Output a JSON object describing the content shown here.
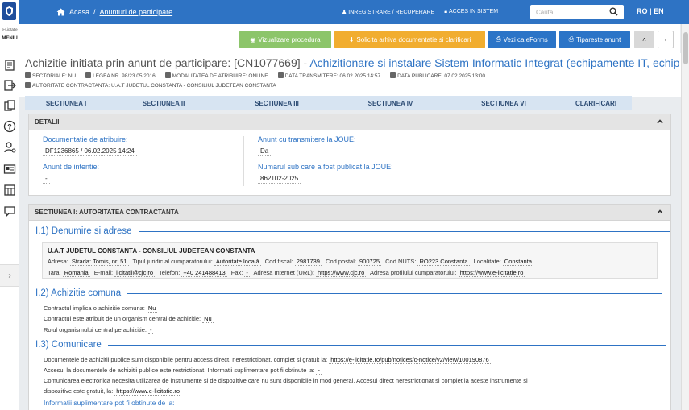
{
  "sidebar": {
    "brand_small": "e-Licitatie",
    "menu_label": "MENIU",
    "icons": [
      "list-icon",
      "export-icon",
      "documents-icon",
      "help-icon",
      "user-settings-icon",
      "id-card-icon",
      "register-icon",
      "chat-icon"
    ],
    "expand_glyph": "›"
  },
  "topbar": {
    "home_label": "Acasa",
    "separator": "/",
    "breadcrumb_link": "Anunturi de participare",
    "register_label": "INREGISTRARE / RECUPERARE",
    "access_label": "ACCES IN SISTEM",
    "search_placeholder": "Cauta...",
    "lang_ro": "RO",
    "lang_sep": "|",
    "lang_en": "EN"
  },
  "actions": {
    "view_label": "Vizualizare procedura",
    "archive_label": "Solicita arhiva documentatie si clarificari",
    "eforms_label": "Vezi ca eForms",
    "print_label": "Tipareste anunt",
    "up_glyph": "˄",
    "left_glyph": "‹"
  },
  "header": {
    "title_prefix": "Achizitie initiata prin anunt de participare: [CN1077669] - ",
    "title_link": "Achizitionare si instalare Sistem Informatic Integrat (echipamente IT, echipam...",
    "meta": [
      "SECTORIALE: NU",
      "LEGEA NR. 98/23.05.2016",
      "MODALITATEA DE ATRIBUIRE: ONLINE",
      "DATA TRANSMITERE: 06.02.2025 14:57",
      "DATA PUBLICARE: 07.02.2025 13:00"
    ],
    "authority": "AUTORITATE CONTRACTANTA: U.A.T JUDETUL CONSTANTA - CONSILIUL JUDETEAN CONSTANTA"
  },
  "tabs": [
    "SECTIUNEA I",
    "SECTIUNEA II",
    "SECTIUNEA III",
    "SECTIUNEA IV",
    "SECTIUNEA VI",
    "CLARIFICARI"
  ],
  "detalii": {
    "header": "DETALII",
    "doc_label": "Documentatie de atribuire:",
    "doc_value": "DF1236865 / 06.02.2025 14:24",
    "intent_label": "Anunt de intentie:",
    "intent_value": "-",
    "joue_label": "Anunt cu transmitere la JOUE:",
    "joue_value": "Da",
    "joue_num_label": "Numarul sub care a fost publicat la JOUE:",
    "joue_num_value": "862102-2025"
  },
  "section1": {
    "header": "SECTIUNEA I: AUTORITATEA CONTRACTANTA",
    "s11_title": "I.1) Denumire si adrese",
    "org_name": "U.A.T JUDETUL CONSTANTA - CONSILIUL JUDETEAN CONSTANTA",
    "address": {
      "adresa_label": "Adresa:",
      "adresa": "Strada: Tomis, nr. 51",
      "tip_label": "Tipul juridic al cumparatorului:",
      "tip": "Autoritate locală",
      "cif_label": "Cod fiscal:",
      "cif": "2981739",
      "postal_label": "Cod postal:",
      "postal": "900725",
      "nuts_label": "Cod NUTS:",
      "nuts": "RO223 Constanta",
      "loc_label": "Localitate:",
      "loc": "Constanta",
      "tara_label": "Tara:",
      "tara": "Romania",
      "email_label": "E-mail:",
      "email": "licitatii@cjc.ro",
      "tel_label": "Telefon:",
      "tel": "+40 241488413",
      "fax_label": "Fax:",
      "fax": "-",
      "url_label": "Adresa Internet (URL):",
      "url": "https://www.cjc.ro",
      "profil_label": "Adresa profilului cumparatorului:",
      "profil": "https://www.e-licitatie.ro"
    },
    "s12_title": "I.2) Achizitie comuna",
    "comuna_label": "Contractul implica o achizitie comuna:",
    "comuna": "Nu",
    "central_label": "Contractul este atribuit de un organism central de achizitie:",
    "central": "Nu",
    "rol_label": "Rolul organismului central pe achizitie:",
    "rol": "-",
    "s13_title": "I.3) Comunicare",
    "docs_label": "Documentele de achizitii publice sunt disponibile pentru access direct, nerestrictionat, complet si gratuit la:",
    "docs_url": "https://e-licitatie.ro/pub/notices/c-notice/v2/view/100190876",
    "restr_label": "Accesul la documentele de achizitii publice este restrictionat. Informatii suplimentare pot fi obtinute la:",
    "restr_value": "-",
    "comm_line1": "Comunicarea electronica necesita utilizarea de instrumente si de dispozitive care nu sunt disponibile in mod general. Accesul direct nerestrictionat si complet la aceste instrumente si",
    "comm_line2_label": "dispozitive este gratuit, la:",
    "comm_line2_value": "https://www.e-licitatie.ro",
    "info_label": "Informatii suplimentare pot fi obtinute de la:"
  }
}
